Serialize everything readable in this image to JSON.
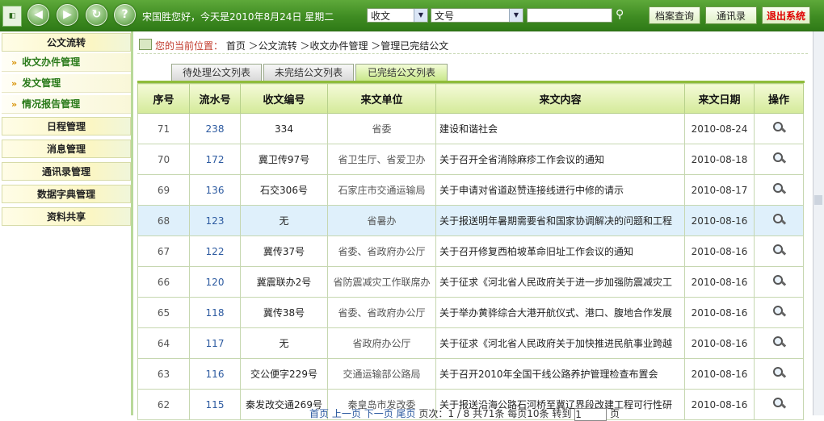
{
  "toolbar": {
    "greeting": "宋国胜您好，今天是2010年8月24日 星期二",
    "select1": "收文",
    "select2": "文号",
    "search_value": "",
    "btn_archive": "档案查询",
    "btn_contacts": "通讯录",
    "btn_exit": "退出系统",
    "icons": [
      "app-logo-icon",
      "back-icon",
      "forward-icon",
      "refresh-icon",
      "help-icon"
    ]
  },
  "sidebar": {
    "items": [
      {
        "label": "公文流转",
        "type": "category"
      },
      {
        "label": "收文办件管理",
        "type": "sub"
      },
      {
        "label": "发文管理",
        "type": "sub"
      },
      {
        "label": "情况报告管理",
        "type": "sub"
      },
      {
        "label": "日程管理",
        "type": "category"
      },
      {
        "label": "消息管理",
        "type": "category"
      },
      {
        "label": "通讯录管理",
        "type": "category"
      },
      {
        "label": "数据字典管理",
        "type": "category"
      },
      {
        "label": "资料共享",
        "type": "category"
      }
    ],
    "bullet": "»"
  },
  "breadcrumb": {
    "label": "您的当前位置：",
    "path": "首页 ＞公文流转 ＞收文办件管理 ＞管理已完结公文"
  },
  "tabs": [
    {
      "label": "待处理公文列表",
      "active": false
    },
    {
      "label": "未完结公文列表",
      "active": false
    },
    {
      "label": "已完结公文列表",
      "active": true
    }
  ],
  "table": {
    "headers": [
      "序号",
      "流水号",
      "收文编号",
      "来文单位",
      "来文内容",
      "来文日期",
      "操作"
    ],
    "rows": [
      [
        "71",
        "238",
        "334",
        "省委",
        "建设和谐社会",
        "2010-08-24"
      ],
      [
        "70",
        "172",
        "冀卫传97号",
        "省卫生厅、省爱卫办",
        "关于召开全省消除麻疹工作会议的通知",
        "2010-08-18"
      ],
      [
        "69",
        "136",
        "石交306号",
        "石家庄市交通运输局",
        "关于申请对省道赵赞连接线进行中修的请示",
        "2010-08-17"
      ],
      [
        "68",
        "123",
        "无",
        "省暑办",
        "关于报送明年暑期需要省和国家协调解决的问题和工程",
        "2010-08-16"
      ],
      [
        "67",
        "122",
        "冀传37号",
        "省委、省政府办公厅",
        "关于召开修复西柏坡革命旧址工作会议的通知",
        "2010-08-16"
      ],
      [
        "66",
        "120",
        "冀震联办2号",
        "省防震减灾工作联席办",
        "关于征求《河北省人民政府关于进一步加强防震减灾工",
        "2010-08-16"
      ],
      [
        "65",
        "118",
        "冀传38号",
        "省委、省政府办公厅",
        "关于举办黄骅综合大港开航仪式、港口、腹地合作发展",
        "2010-08-16"
      ],
      [
        "64",
        "117",
        "无",
        "省政府办公厅",
        "关于征求《河北省人民政府关于加快推进民航事业跨越",
        "2010-08-16"
      ],
      [
        "63",
        "116",
        "交公便字229号",
        "交通运输部公路局",
        "关于召开2010年全国干线公路养护管理检查布置会",
        "2010-08-16"
      ],
      [
        "62",
        "115",
        "秦发改交通269号",
        "秦皇岛市发改委",
        "关于报送沿海公路石河桥至冀辽界段改建工程可行性研",
        "2010-08-16"
      ]
    ],
    "highlight_row": 3,
    "action_icon": "magnifier-icon"
  },
  "pager": {
    "first": "首页",
    "prev": "上一页",
    "next": "下一页",
    "last": "尾页",
    "page_info": "页次：1 / 8",
    "total": "共71条",
    "per_page": "每页10条",
    "goto_label": "转到",
    "goto_value": "1",
    "page_suffix": "页"
  },
  "colors": {
    "topbar": "#3f8c22",
    "exit": "#e00000",
    "accent": "#8fbc3a",
    "highlight": "#dff0fb"
  }
}
